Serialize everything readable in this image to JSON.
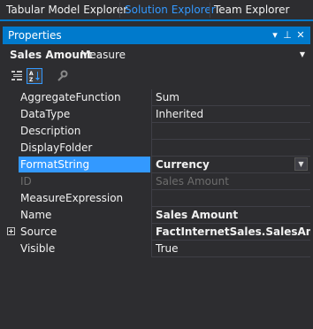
{
  "tabs": [
    {
      "label": "Tabular Model Explorer",
      "active": false
    },
    {
      "label": "Solution Explorer",
      "active": true
    },
    {
      "label": "Team Explorer",
      "active": false
    }
  ],
  "panel": {
    "title": "Properties",
    "buttons": {
      "dropdown": "▾",
      "pin": "⊥",
      "close": "✕"
    }
  },
  "selector": {
    "object_name": "Sales Amount",
    "object_type": "Measure",
    "dropdown_glyph": "▼"
  },
  "toolbar": {
    "categorized_icon": "categorized-view-icon",
    "alphabetical_icon": "alphabetical-sort-icon",
    "property_pages_icon": "wrench-icon",
    "alphabetical_selected": true
  },
  "properties": [
    {
      "name": "AggregateFunction",
      "value": "Sum"
    },
    {
      "name": "DataType",
      "value": "Inherited"
    },
    {
      "name": "Description",
      "value": ""
    },
    {
      "name": "DisplayFolder",
      "value": ""
    },
    {
      "name": "FormatString",
      "value": "Currency"
    },
    {
      "name": "ID",
      "value": "Sales Amount"
    },
    {
      "name": "MeasureExpression",
      "value": ""
    },
    {
      "name": "Name",
      "value": "Sales Amount"
    },
    {
      "name": "Source",
      "value": "FactInternetSales.SalesAmount"
    },
    {
      "name": "Visible",
      "value": "True"
    }
  ],
  "colors": {
    "accent": "#007acc",
    "selection": "#3399ff",
    "background": "#2d2d30",
    "disabled_text": "#6d6d6d"
  }
}
